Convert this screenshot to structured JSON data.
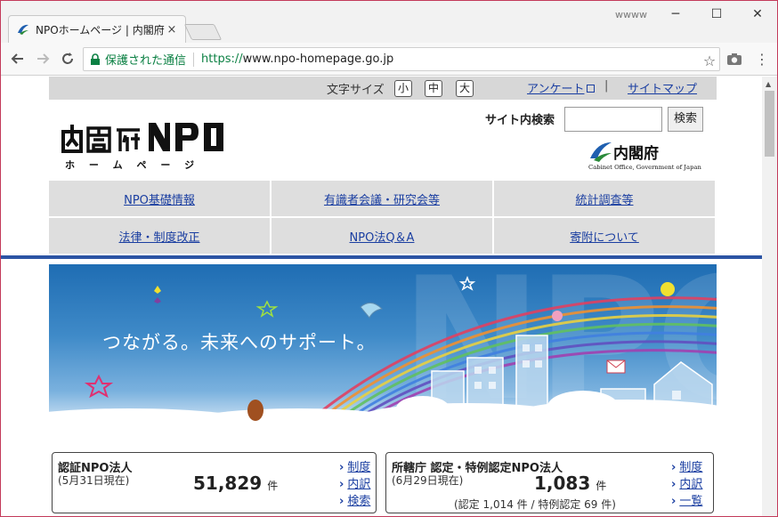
{
  "browser": {
    "tab_title": "NPOホームページ | 内閣府",
    "tab_close": "×",
    "window_label": "wwww",
    "minimize": "─",
    "maximize": "☐",
    "close": "✕",
    "secure_label": "保護された通信",
    "url_scheme": "https://",
    "url_host": "www.npo-homepage.go.jp"
  },
  "header": {
    "font_size_label": "文字サイズ",
    "font_size_small": "小",
    "font_size_medium": "中",
    "font_size_large": "大",
    "survey_link": "アンケート",
    "separator": "|",
    "sitemap_link": "サイトマップ",
    "search_label": "サイト内検索",
    "search_value": "",
    "search_button": "検索",
    "logo_text": "内閣府NPO",
    "logo_sub": "ホ ー ム ペ ー ジ",
    "cabinet_name": "内閣府",
    "cabinet_en": "Cabinet Office, Government of Japan"
  },
  "nav": {
    "items": [
      "NPO基礎情報",
      "有識者会議・研究会等",
      "統計調査等",
      "法律・制度改正",
      "NPO法Q＆A",
      "寄附について"
    ]
  },
  "hero": {
    "tagline": "つながる。未来へのサポート。",
    "bg_word": "NPO"
  },
  "stats": {
    "left": {
      "title": "認証NPO法人",
      "date": "(5月31日現在)",
      "count": "51,829",
      "unit": "件",
      "links": [
        "制度",
        "内訳",
        "検索"
      ]
    },
    "right": {
      "title": "所轄庁 認定・特例認定NPO法人",
      "date": "(6月29日現在)",
      "count": "1,083",
      "unit": "件",
      "breakdown": "(認定 1,014 件 / 特例認定 69 件)",
      "links": [
        "制度",
        "内訳",
        "一覧"
      ]
    }
  },
  "colors": {
    "link": "#1a3ea1",
    "nav_rule": "#2c54a4",
    "secure_green": "#0b8043"
  }
}
